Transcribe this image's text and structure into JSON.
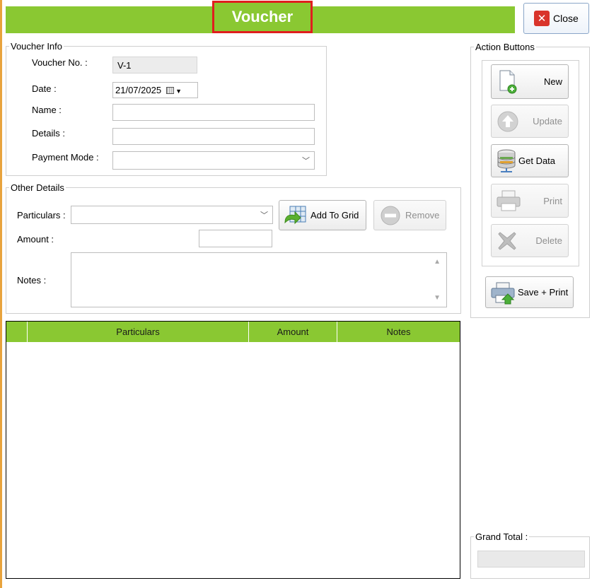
{
  "header": {
    "title": "Voucher",
    "close_label": "Close"
  },
  "voucher_info": {
    "legend": "Voucher Info",
    "voucher_no_label": "Voucher No. :",
    "voucher_no_value": "V-1",
    "date_label": "Date :",
    "date_value": "21/07/2025",
    "name_label": "Name :",
    "name_value": "",
    "details_label": "Details :",
    "details_value": "",
    "payment_mode_label": "Payment Mode :",
    "payment_mode_value": ""
  },
  "other_details": {
    "legend": "Other Details",
    "particulars_label": "Particulars :",
    "particulars_value": "",
    "amount_label": "Amount :",
    "amount_value": "",
    "notes_label": "Notes :",
    "notes_value": "",
    "add_to_grid_label": "Add To Grid",
    "remove_label": "Remove"
  },
  "grid": {
    "columns": [
      "",
      "Particulars",
      "Amount",
      "Notes"
    ]
  },
  "actions": {
    "legend": "Action Buttons",
    "new_label": "New",
    "update_label": "Update",
    "get_data_label": "Get Data",
    "print_label": "Print",
    "delete_label": "Delete",
    "save_print_label": "Save + Print"
  },
  "grand_total": {
    "legend": "Grand Total :",
    "value": ""
  },
  "colors": {
    "accent_green": "#8ac832",
    "highlight_red": "#e01e1e",
    "left_border": "#e8a33d"
  }
}
